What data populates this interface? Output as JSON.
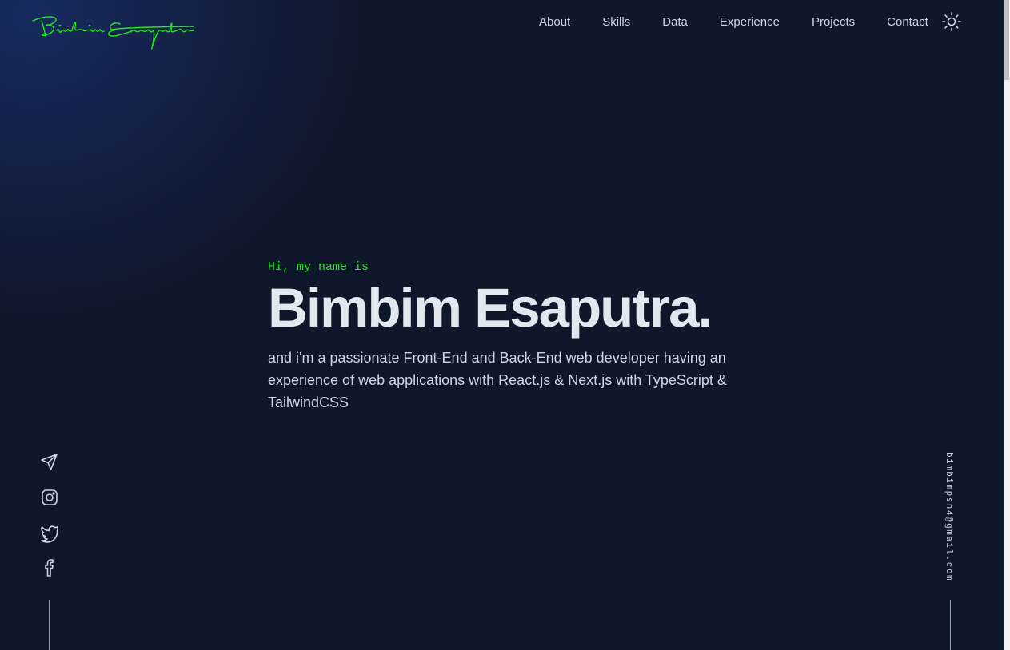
{
  "header": {
    "logo_text": "Bimbim Esaputra",
    "logo_color": "#22e51f",
    "nav": [
      {
        "label": "About"
      },
      {
        "label": "Skills"
      },
      {
        "label": "Data"
      },
      {
        "label": "Experience"
      },
      {
        "label": "Projects"
      },
      {
        "label": "Contact"
      }
    ],
    "theme_toggle_icon": "sun-icon"
  },
  "hero": {
    "greeting": "Hi, my name is",
    "name": "Bimbim Esaputra.",
    "description": "and i'm a passionate Front-End and Back-End web developer having an experience of web applications with React.js & Next.js with TypeScript & TailwindCSS"
  },
  "socials": [
    {
      "icon": "send-icon"
    },
    {
      "icon": "instagram-icon"
    },
    {
      "icon": "twitter-icon"
    },
    {
      "icon": "facebook-icon"
    }
  ],
  "email": "bimbimpsn4@gmail.com",
  "colors": {
    "background": "#0f172a",
    "accent": "#22e51f",
    "text": "#e2e8f0",
    "muted": "#cbd5e1"
  }
}
